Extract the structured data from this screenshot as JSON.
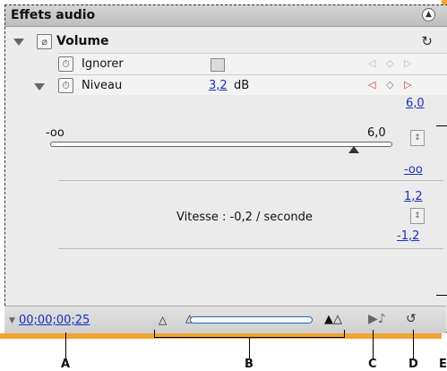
{
  "panel": {
    "title": "Effets audio",
    "effect_name": "Volume"
  },
  "params": {
    "bypass": {
      "label": "Ignorer",
      "checked": false
    },
    "level": {
      "label": "Niveau",
      "value": "3,2",
      "unit": "dB"
    }
  },
  "slider": {
    "min_label": "-oo",
    "max_label": "6,0",
    "position_fraction": 0.9
  },
  "graph": {
    "top_scale": [
      "6,0",
      "-oo"
    ],
    "bottom_scale": [
      "1,2",
      "-1,2"
    ],
    "velocity_text": "Vitesse : -0,2 / seconde"
  },
  "footer": {
    "timecode": "00;00;00;25"
  },
  "callouts": [
    "A",
    "B",
    "C",
    "D",
    "E"
  ],
  "colors": {
    "accent_link": "#1b2fb8",
    "frame": "#f2a52f",
    "zoom_blue": "#2a64b6"
  }
}
